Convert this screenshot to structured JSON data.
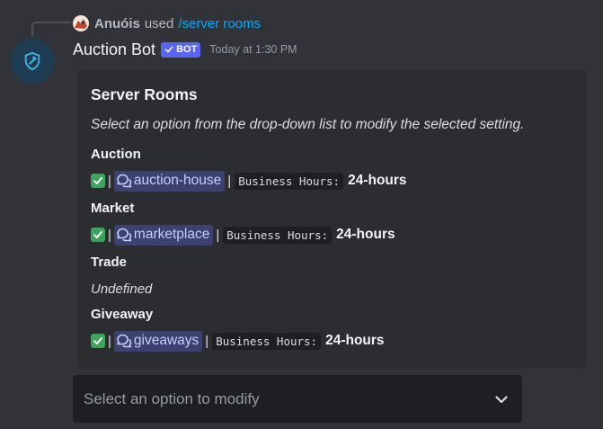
{
  "reply": {
    "username": "Anuóis",
    "used_text": "used",
    "command": "/server rooms"
  },
  "message": {
    "author": "Auction Bot",
    "bot_tag": "BOT",
    "timestamp": "Today at 1:30 PM"
  },
  "embed": {
    "title": "Server Rooms",
    "description": "Select an option from the drop-down list to modify the selected setting.",
    "fields": [
      {
        "name": "Auction",
        "channel": "auction-house",
        "hours_label": "Business Hours:",
        "hours_value": "24-hours"
      },
      {
        "name": "Market",
        "channel": "marketplace",
        "hours_label": "Business Hours:",
        "hours_value": "24-hours"
      },
      {
        "name": "Trade",
        "value": "Undefined"
      },
      {
        "name": "Giveaway",
        "channel": "giveaways",
        "hours_label": "Business Hours:",
        "hours_value": "24-hours"
      }
    ],
    "separator": "|"
  },
  "select_menu": {
    "placeholder": "Select an option to modify"
  },
  "colors": {
    "background": "#313338",
    "embed_background": "#2b2d31",
    "bot_tag": "#5865f2",
    "command_link": "#00a8fc",
    "channel_mention_bg": "#3c4270",
    "check": "#3ba55c"
  },
  "icons": {
    "bot_avatar": "shield-hammer-icon",
    "check": "check-mark-icon",
    "channel": "forum-channel-icon",
    "dropdown": "chevron-down-icon"
  }
}
